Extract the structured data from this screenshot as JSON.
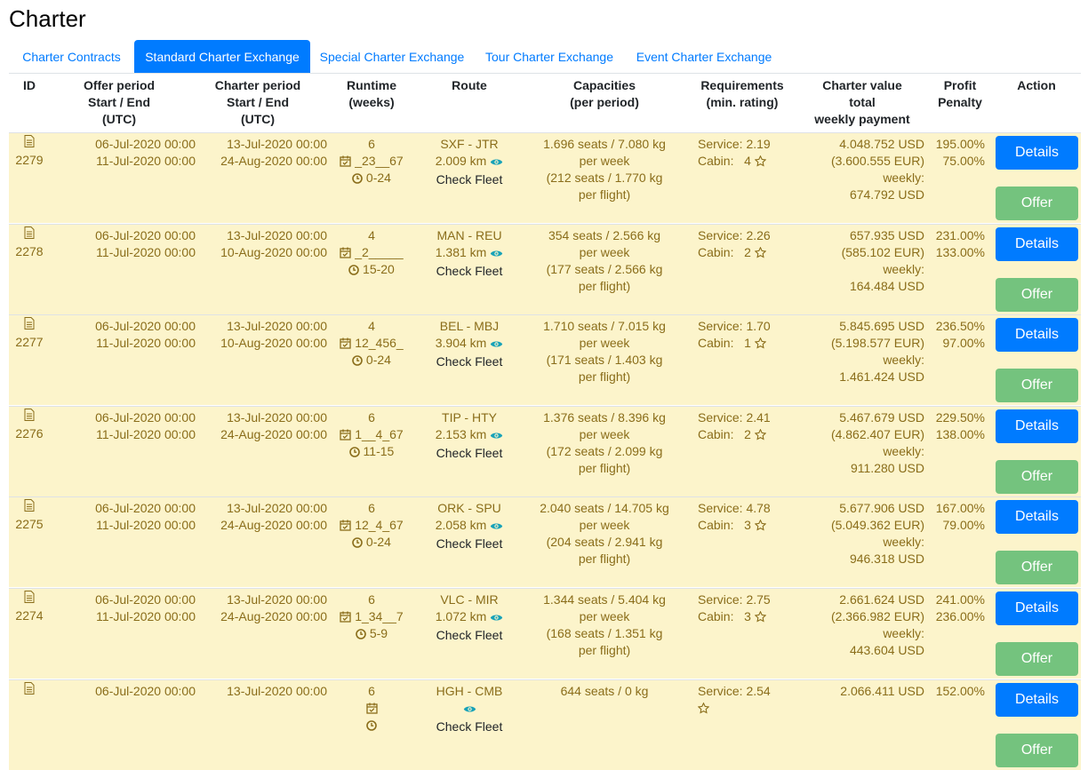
{
  "page": {
    "title": "Charter"
  },
  "tabs": [
    {
      "label": "Charter Contracts"
    },
    {
      "label": "Standard Charter Exchange"
    },
    {
      "label": "Special Charter Exchange"
    },
    {
      "label": "Tour Charter Exchange"
    },
    {
      "label": "Event Charter Exchange"
    }
  ],
  "columns": {
    "id": [
      "ID"
    ],
    "offer": [
      "Offer period",
      "Start / End",
      "(UTC)"
    ],
    "charter": [
      "Charter period",
      "Start / End",
      "(UTC)"
    ],
    "runtime": [
      "Runtime",
      "(weeks)"
    ],
    "route": [
      "Route"
    ],
    "cap": [
      "Capacities",
      "(per period)"
    ],
    "req": [
      "Requirements",
      "(min. rating)"
    ],
    "val": [
      "Charter value",
      "total",
      "weekly payment"
    ],
    "profit": [
      "Profit",
      "Penalty"
    ],
    "action": [
      "Action"
    ]
  },
  "buttons": {
    "details": "Details",
    "offer": "Offer",
    "check_fleet": "Check Fleet"
  },
  "rows": [
    {
      "id": "2279",
      "offer_start": "06-Jul-2020 00:00",
      "offer_end": "11-Jul-2020 00:00",
      "charter_start": "13-Jul-2020 00:00",
      "charter_end": "24-Aug-2020 00:00",
      "weeks": "6",
      "days": "_23__67",
      "hours": "0-24",
      "route": "SXF - JTR",
      "distance": "2.009 km",
      "cap1": "1.696 seats / 7.080 kg",
      "cap2": "per week",
      "cap3": "(212 seats / 1.770 kg",
      "cap4": "per flight)",
      "service": "Service: 2.19",
      "cabin": "Cabin:   4",
      "value": "4.048.752 USD",
      "value_eur": "(3.600.555 EUR)",
      "weekly_label": "weekly:",
      "weekly": "674.792 USD",
      "profit": "195.00%",
      "penalty": "75.00%"
    },
    {
      "id": "2278",
      "offer_start": "06-Jul-2020 00:00",
      "offer_end": "11-Jul-2020 00:00",
      "charter_start": "13-Jul-2020 00:00",
      "charter_end": "10-Aug-2020 00:00",
      "weeks": "4",
      "days": "_2_____",
      "hours": "15-20",
      "route": "MAN - REU",
      "distance": "1.381 km",
      "cap1": "354 seats / 2.566 kg",
      "cap2": "per week",
      "cap3": "(177 seats / 2.566 kg",
      "cap4": "per flight)",
      "service": "Service: 2.26",
      "cabin": "Cabin:   2",
      "value": "657.935 USD",
      "value_eur": "(585.102 EUR)",
      "weekly_label": "weekly:",
      "weekly": "164.484 USD",
      "profit": "231.00%",
      "penalty": "133.00%"
    },
    {
      "id": "2277",
      "offer_start": "06-Jul-2020 00:00",
      "offer_end": "11-Jul-2020 00:00",
      "charter_start": "13-Jul-2020 00:00",
      "charter_end": "10-Aug-2020 00:00",
      "weeks": "4",
      "days": "12_456_",
      "hours": "0-24",
      "route": "BEL - MBJ",
      "distance": "3.904 km",
      "cap1": "1.710 seats / 7.015 kg",
      "cap2": "per week",
      "cap3": "(171 seats / 1.403 kg",
      "cap4": "per flight)",
      "service": "Service: 1.70",
      "cabin": "Cabin:   1",
      "value": "5.845.695 USD",
      "value_eur": "(5.198.577 EUR)",
      "weekly_label": "weekly:",
      "weekly": "1.461.424 USD",
      "profit": "236.50%",
      "penalty": "97.00%"
    },
    {
      "id": "2276",
      "offer_start": "06-Jul-2020 00:00",
      "offer_end": "11-Jul-2020 00:00",
      "charter_start": "13-Jul-2020 00:00",
      "charter_end": "24-Aug-2020 00:00",
      "weeks": "6",
      "days": "1__4_67",
      "hours": "11-15",
      "route": "TIP - HTY",
      "distance": "2.153 km",
      "cap1": "1.376 seats / 8.396 kg",
      "cap2": "per week",
      "cap3": "(172 seats / 2.099 kg",
      "cap4": "per flight)",
      "service": "Service: 2.41",
      "cabin": "Cabin:   2",
      "value": "5.467.679 USD",
      "value_eur": "(4.862.407 EUR)",
      "weekly_label": "weekly:",
      "weekly": "911.280 USD",
      "profit": "229.50%",
      "penalty": "138.00%"
    },
    {
      "id": "2275",
      "offer_start": "06-Jul-2020 00:00",
      "offer_end": "11-Jul-2020 00:00",
      "charter_start": "13-Jul-2020 00:00",
      "charter_end": "24-Aug-2020 00:00",
      "weeks": "6",
      "days": "12_4_67",
      "hours": "0-24",
      "route": "ORK - SPU",
      "distance": "2.058 km",
      "cap1": "2.040 seats / 14.705 kg",
      "cap2": "per week",
      "cap3": "(204 seats / 2.941 kg",
      "cap4": "per flight)",
      "service": "Service: 4.78",
      "cabin": "Cabin:   3",
      "value": "5.677.906 USD",
      "value_eur": "(5.049.362 EUR)",
      "weekly_label": "weekly:",
      "weekly": "946.318 USD",
      "profit": "167.00%",
      "penalty": "79.00%"
    },
    {
      "id": "2274",
      "offer_start": "06-Jul-2020 00:00",
      "offer_end": "11-Jul-2020 00:00",
      "charter_start": "13-Jul-2020 00:00",
      "charter_end": "24-Aug-2020 00:00",
      "weeks": "6",
      "days": "1_34__7",
      "hours": "5-9",
      "route": "VLC - MIR",
      "distance": "1.072 km",
      "cap1": "1.344 seats / 5.404 kg",
      "cap2": "per week",
      "cap3": "(168 seats / 1.351 kg",
      "cap4": "per flight)",
      "service": "Service: 2.75",
      "cabin": "Cabin:   3",
      "value": "2.661.624 USD",
      "value_eur": "(2.366.982 EUR)",
      "weekly_label": "weekly:",
      "weekly": "443.604 USD",
      "profit": "241.00%",
      "penalty": "236.00%"
    },
    {
      "id": "",
      "offer_start": "06-Jul-2020 00:00",
      "offer_end": "",
      "charter_start": "13-Jul-2020 00:00",
      "charter_end": "",
      "weeks": "6",
      "days": "",
      "hours": "",
      "route": "HGH - CMB",
      "distance": "",
      "cap1": "644 seats / 0 kg",
      "cap2": "",
      "cap3": "",
      "cap4": "",
      "service": "Service: 2.54",
      "cabin": "",
      "value": "2.066.411 USD",
      "value_eur": "",
      "weekly_label": "",
      "weekly": "",
      "profit": "152.00%",
      "penalty": ""
    }
  ]
}
